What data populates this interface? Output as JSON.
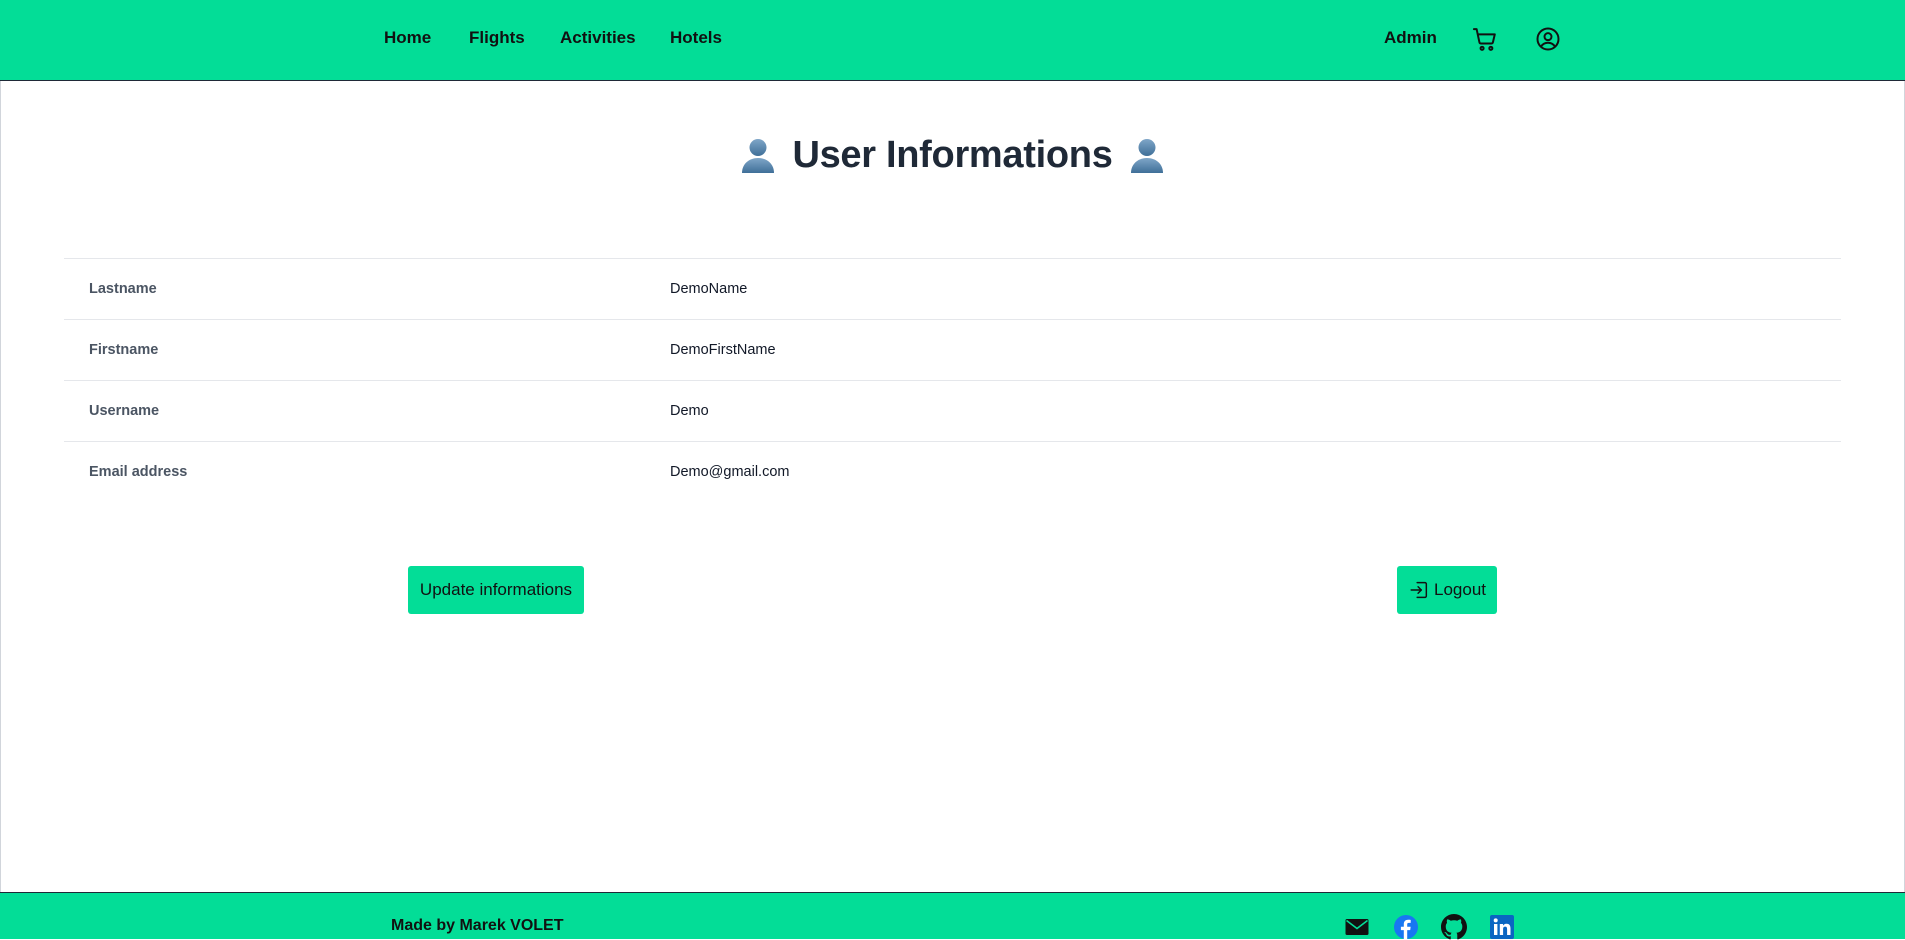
{
  "nav": {
    "links": [
      {
        "label": "Home"
      },
      {
        "label": "Flights"
      },
      {
        "label": "Activities"
      },
      {
        "label": "Hotels"
      }
    ],
    "admin_label": "Admin",
    "cart_icon": "shopping-cart-icon",
    "account_icon": "user-circle-icon"
  },
  "main": {
    "title": "User Informations",
    "title_icon": "bust-in-silhouette-icon",
    "fields": [
      {
        "label": "Lastname",
        "value": "DemoName"
      },
      {
        "label": "Firstname",
        "value": "DemoFirstName"
      },
      {
        "label": "Username",
        "value": "Demo"
      },
      {
        "label": "Email address",
        "value": "Demo@gmail.com"
      }
    ],
    "update_button": "Update informations",
    "logout_button": "Logout",
    "logout_icon": "login-arrow-icon"
  },
  "footer": {
    "credit": "Made by Marek VOLET",
    "social": [
      "mail-icon",
      "facebook-icon",
      "github-icon",
      "linkedin-icon"
    ]
  },
  "colors": {
    "brand": "#03dd97",
    "facebook": "#1877f2",
    "linkedin": "#0a66c2",
    "title": "#1f2937"
  }
}
